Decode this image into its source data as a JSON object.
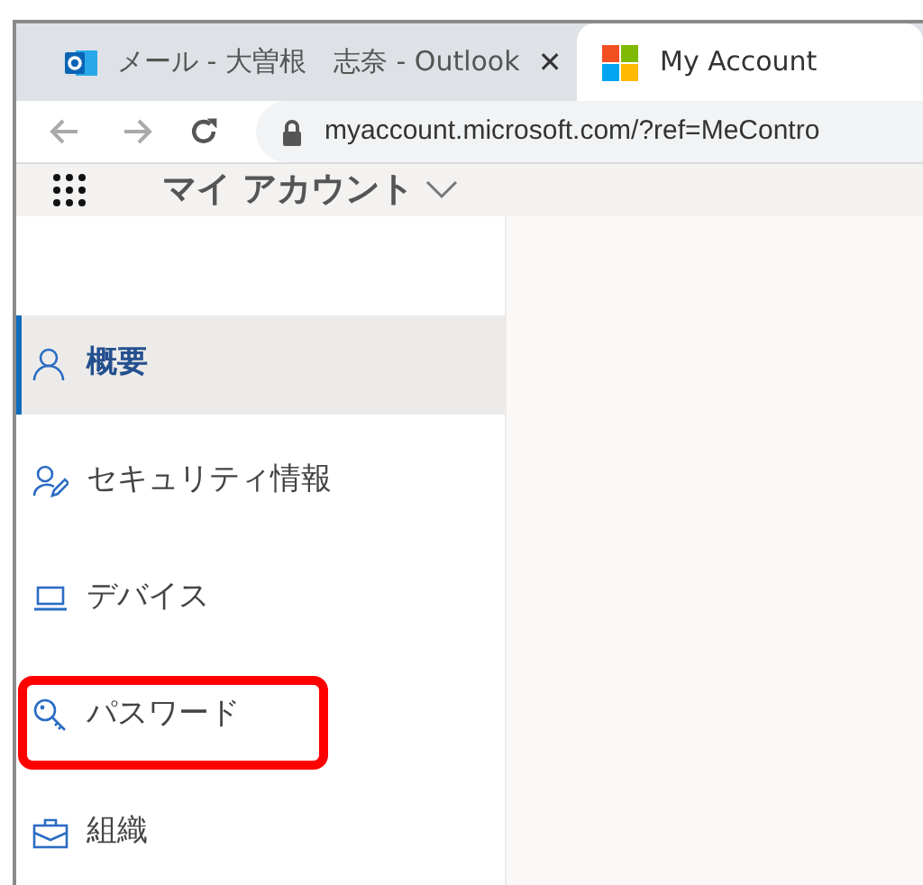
{
  "browser": {
    "tabs": [
      {
        "label": "メール - 大曽根　志奈 - Outlook",
        "close": "✕",
        "selected": false
      },
      {
        "label": "My Account",
        "selected": true
      }
    ],
    "address": "myaccount.microsoft.com/?ref=MeContro"
  },
  "header": {
    "title": "マイ アカウント"
  },
  "sidebar": {
    "items": [
      {
        "label": "概要",
        "selected": true,
        "highlighted": false
      },
      {
        "label": "セキュリティ情報",
        "selected": false,
        "highlighted": false
      },
      {
        "label": "デバイス",
        "selected": false,
        "highlighted": false
      },
      {
        "label": "パスワード",
        "selected": false,
        "highlighted": true
      },
      {
        "label": "組織",
        "selected": false,
        "highlighted": false
      }
    ]
  }
}
